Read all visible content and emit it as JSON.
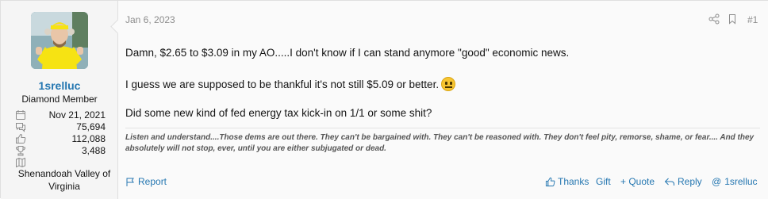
{
  "user": {
    "name": "1srelluc",
    "title": "Diamond Member",
    "avatar_icon": "user-avatar-photo",
    "stats": [
      {
        "icon": "calendar-icon",
        "value": "Nov 21, 2021"
      },
      {
        "icon": "messages-icon",
        "value": "75,694"
      },
      {
        "icon": "thumbs-up-icon",
        "value": "112,088"
      },
      {
        "icon": "trophy-icon",
        "value": "3,488"
      },
      {
        "icon": "location-icon",
        "value": ""
      }
    ],
    "location": "Shenandoah Valley of Virginia"
  },
  "post": {
    "date": "Jan 6, 2023",
    "number": "#1",
    "paragraphs": [
      "Damn, $2.65 to $3.09 in my AO.....I don't know if I can stand anymore \"good\" economic news.",
      "I guess we are supposed to be thankful it's not still $5.09 or better.",
      "Did some new kind of fed energy tax kick-in on 1/1 or some shit?"
    ],
    "signature": "Listen and understand....Those dems are out there. They can't be bargained with. They can't be reasoned with. They don't feel pity, remorse, shame, or fear.... And they absolutely will not stop, ever, until you are either subjugated or dead."
  },
  "actions": {
    "report": "Report",
    "thanks": "Thanks",
    "gift": "Gift",
    "quote": "+ Quote",
    "reply": "Reply",
    "mention": "1srelluc"
  },
  "colors": {
    "link": "#2577b1",
    "muted": "#8c8c8c",
    "sidebar_bg": "#f5f5f5"
  }
}
